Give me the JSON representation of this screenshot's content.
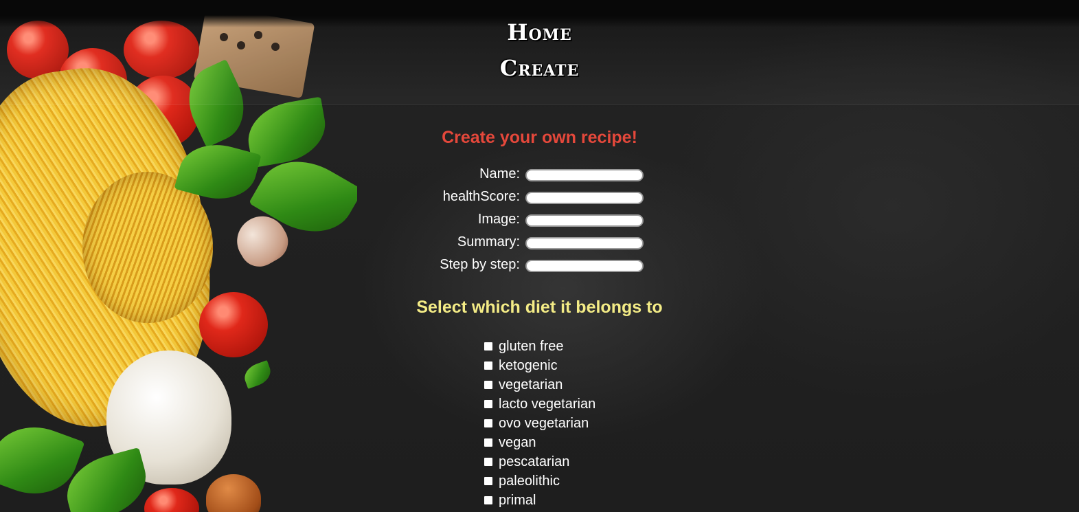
{
  "nav": {
    "home_label": "Home",
    "create_label": "Create"
  },
  "form": {
    "title": "Create your own recipe!",
    "fields": [
      {
        "label": "Name:",
        "value": ""
      },
      {
        "label": "healthScore:",
        "value": ""
      },
      {
        "label": "Image:",
        "value": ""
      },
      {
        "label": "Summary:",
        "value": ""
      },
      {
        "label": "Step by step:",
        "value": ""
      }
    ]
  },
  "diets": {
    "title": "Select which diet it belongs to",
    "options": [
      {
        "label": "gluten free",
        "checked": false
      },
      {
        "label": "ketogenic",
        "checked": false
      },
      {
        "label": "vegetarian",
        "checked": false
      },
      {
        "label": "lacto vegetarian",
        "checked": false
      },
      {
        "label": "ovo vegetarian",
        "checked": false
      },
      {
        "label": "vegan",
        "checked": false
      },
      {
        "label": "pescatarian",
        "checked": false
      },
      {
        "label": "paleolithic",
        "checked": false
      },
      {
        "label": "primal",
        "checked": false
      }
    ]
  },
  "colors": {
    "title_red": "#e5483b",
    "title_yellow": "#f4ec86",
    "background": "#1d1d1d"
  }
}
